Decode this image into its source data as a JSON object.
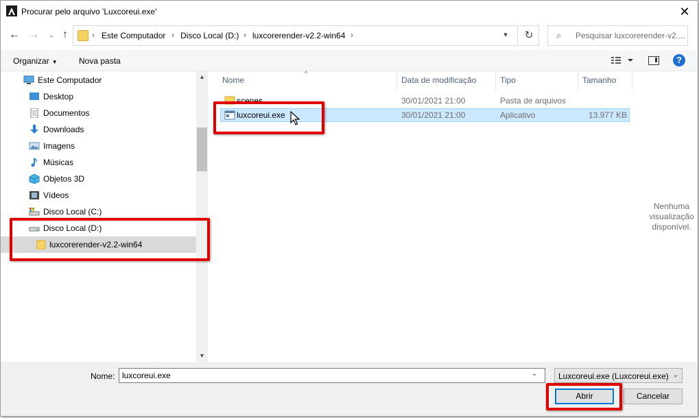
{
  "window": {
    "title": "Procurar pelo arquivo 'Luxcoreui.exe'"
  },
  "address": {
    "crumbs": [
      "Este Computador",
      "Disco Local (D:)",
      "luxcorerender-v2.2-win64"
    ],
    "search_placeholder": "Pesquisar luxcorerender-v2...."
  },
  "toolbar": {
    "organize": "Organizar",
    "new_folder": "Nova pasta"
  },
  "sidebar": {
    "items": [
      {
        "label": "Este Computador",
        "icon": "computer-icon"
      },
      {
        "label": "Desktop",
        "icon": "desktop-icon"
      },
      {
        "label": "Documentos",
        "icon": "documents-icon"
      },
      {
        "label": "Downloads",
        "icon": "downloads-icon"
      },
      {
        "label": "Imagens",
        "icon": "images-icon"
      },
      {
        "label": "Músicas",
        "icon": "music-icon"
      },
      {
        "label": "Objetos 3D",
        "icon": "3d-objects-icon"
      },
      {
        "label": "Vídeos",
        "icon": "videos-icon"
      },
      {
        "label": "Disco Local (C:)",
        "icon": "drive-c-icon"
      },
      {
        "label": "Disco Local (D:)",
        "icon": "drive-d-icon"
      },
      {
        "label": "luxcorerender-v2.2-win64",
        "icon": "folder-icon"
      }
    ]
  },
  "columns": {
    "name": "Nome",
    "modified": "Data de modificação",
    "type": "Tipo",
    "size": "Tamanho"
  },
  "files": [
    {
      "name": "scenes",
      "modified": "30/01/2021 21:00",
      "type": "Pasta de arquivos",
      "size": ""
    },
    {
      "name": "luxcoreui.exe",
      "modified": "30/01/2021 21:00",
      "type": "Aplicativo",
      "size": "13.977 KB"
    }
  ],
  "preview": {
    "text": "Nenhuma visualização disponível."
  },
  "footer": {
    "filename_label": "Nome:",
    "filename_value": "luxcoreui.exe",
    "filetype_value": "Luxcoreui.exe  (Luxcoreui.exe)",
    "open_button": "Abrir",
    "cancel_button": "Cancelar"
  },
  "colors": {
    "highlight": "#e00000",
    "selection": "#cce8ff",
    "accent": "#0078d7"
  }
}
